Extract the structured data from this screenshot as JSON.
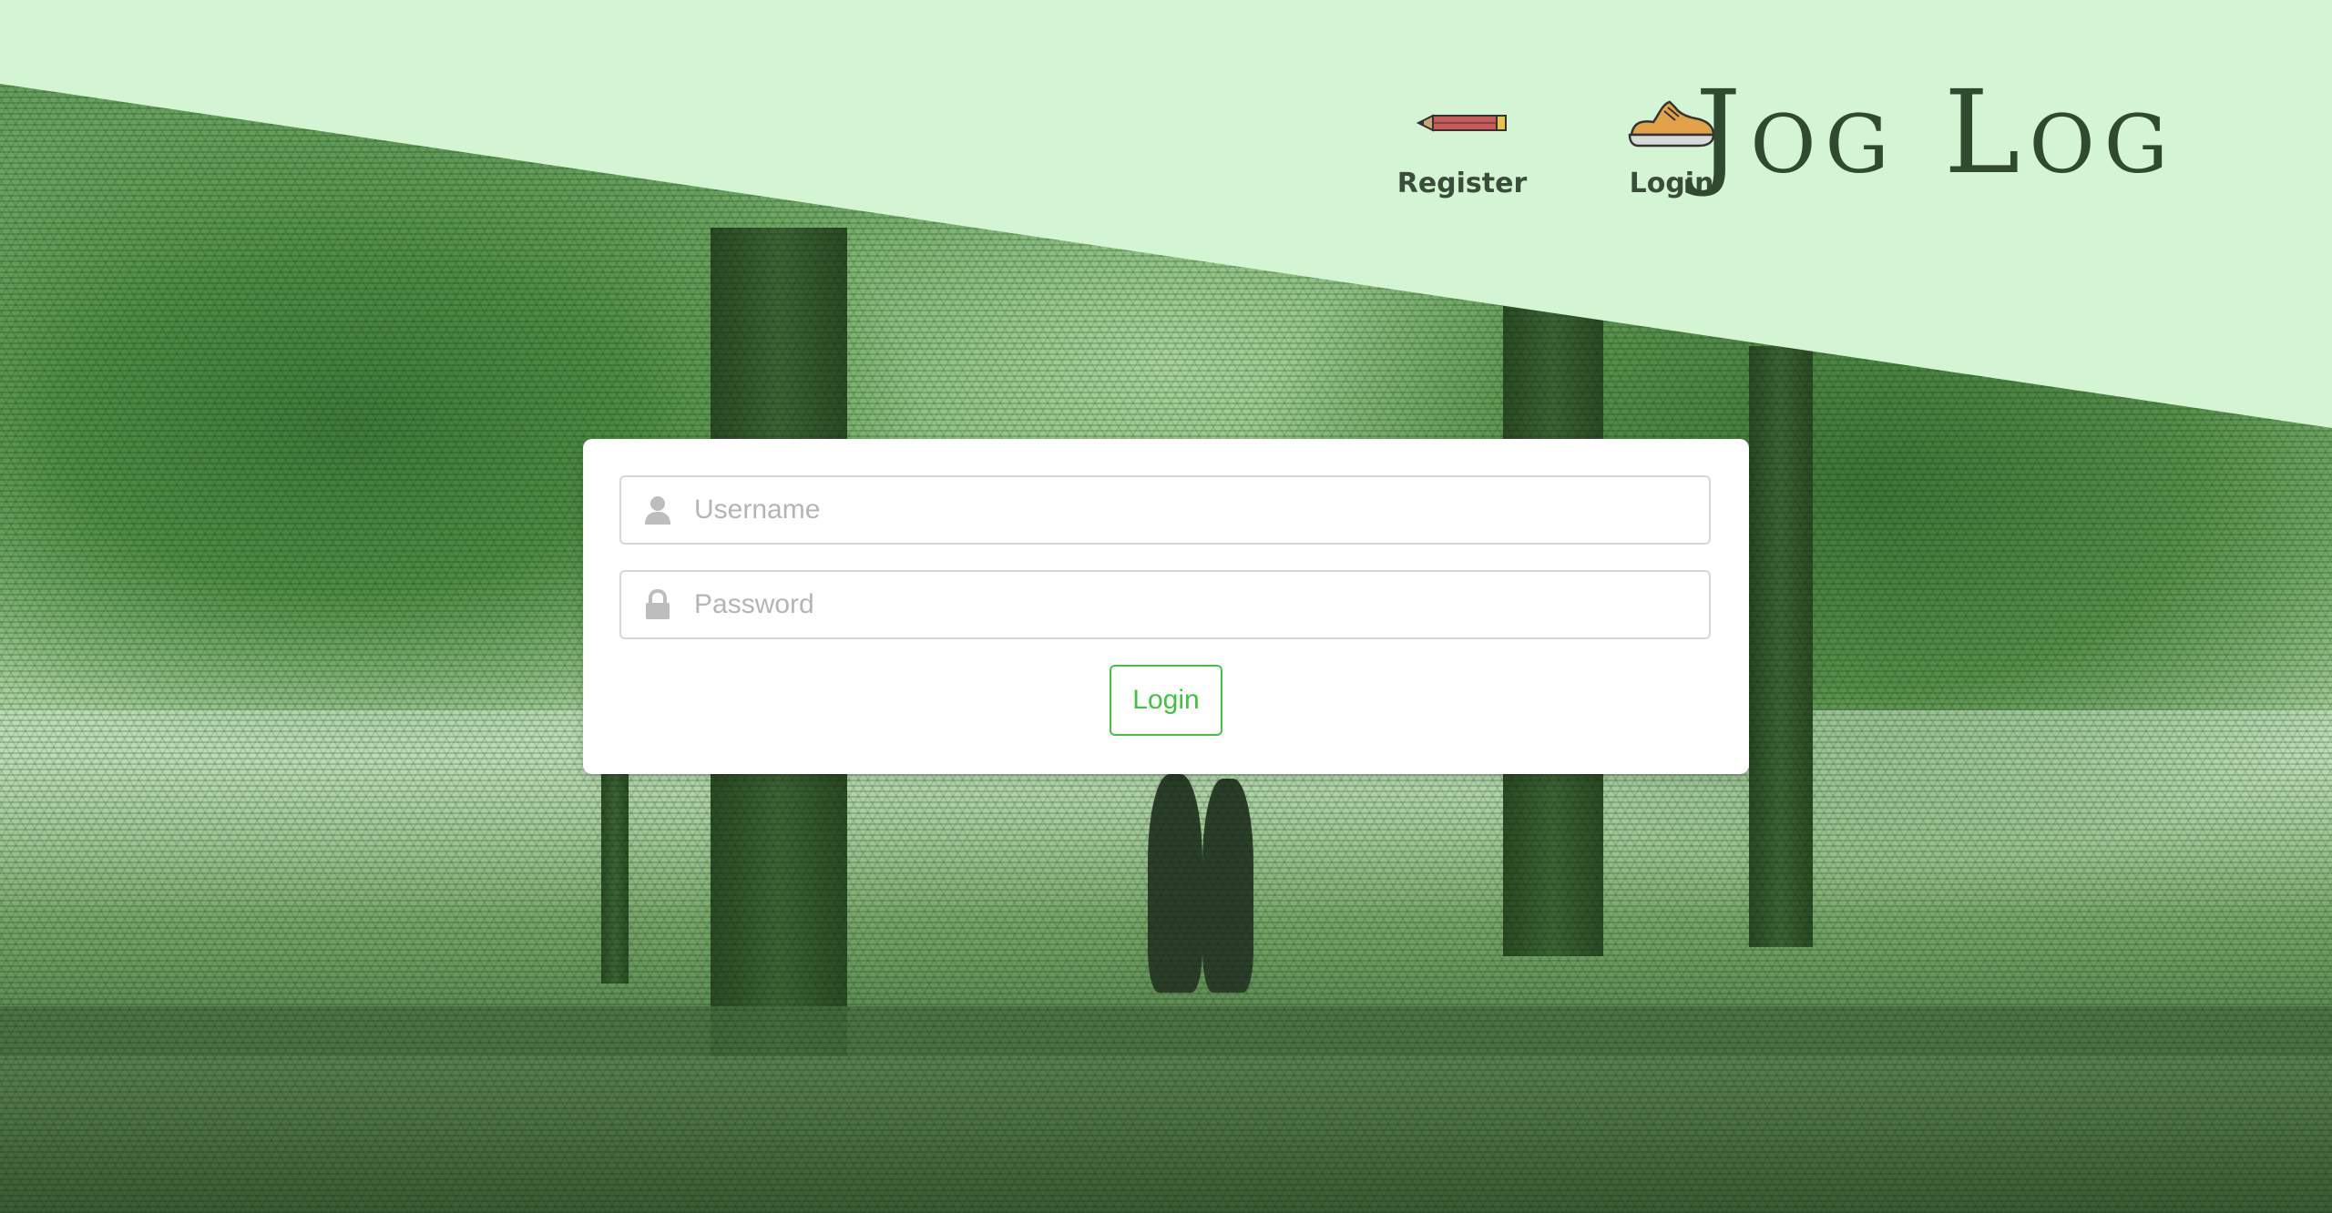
{
  "brand": {
    "title": "Jog Log"
  },
  "nav": {
    "register": {
      "label": "Register",
      "icon": "pencil-icon"
    },
    "login": {
      "label": "Login",
      "icon": "running-shoe-icon"
    }
  },
  "login_form": {
    "username": {
      "placeholder": "Username",
      "value": "",
      "icon": "user-icon"
    },
    "password": {
      "placeholder": "Password",
      "value": "",
      "icon": "lock-icon"
    },
    "submit_label": "Login"
  },
  "colors": {
    "header_bg": "#d4f5d4",
    "accent_green": "#3ec43e",
    "brand_text": "#2f4a2f"
  }
}
